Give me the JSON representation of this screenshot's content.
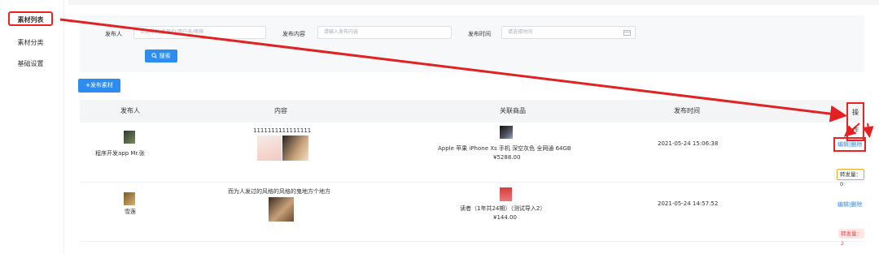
{
  "sidebar": {
    "items": [
      {
        "label": "素材列表",
        "active": true
      },
      {
        "label": "素材分类",
        "active": false
      },
      {
        "label": "基础设置",
        "active": false
      }
    ]
  },
  "filter": {
    "publisher_label": "发布人",
    "publisher_placeholder": "手机号码/会员ID/用户名/昵称",
    "content_label": "发布内容",
    "content_placeholder": "请输入发布内容",
    "time_label": "发布时间",
    "time_placeholder": "请选择时间",
    "search_label": "搜索"
  },
  "add_button_label": "发布素材",
  "table": {
    "headers": [
      "发布人",
      "内容",
      "关联商品",
      "发布时间",
      "操作"
    ],
    "rows": [
      {
        "publisher": "程序开发app Mr.张",
        "content_text": "1111111111111111",
        "product_name": "Apple 苹果 iPhone Xs 手机 深空灰色 全网通 64GB",
        "product_price": "¥5288.00",
        "time": "2021-05-24 15:06:38",
        "edit": "编辑",
        "sep": "|",
        "delete": "删除",
        "forward": "转发量：0"
      },
      {
        "publisher": "雪莲",
        "content_text": "而为人发过的风格的风格的鬼地方个地方",
        "product_name": "读者（1年共24期）（测试导入2）",
        "product_price": "¥144.00",
        "time": "2021-05-24 14:57:52",
        "edit": "编辑",
        "sep": "|",
        "delete": "删除",
        "forward": "转发量：2"
      }
    ]
  },
  "colors": {
    "primary": "#2d8cf0",
    "annotation_red": "#e22222",
    "badge_orange": "#f5a623",
    "badge_pink": "#fde8e8"
  },
  "icons": [
    "search-icon",
    "plus-icon",
    "calendar-icon",
    "annotation-arrow"
  ]
}
